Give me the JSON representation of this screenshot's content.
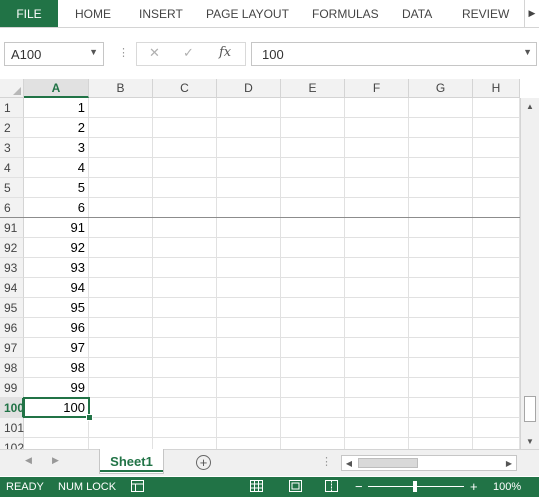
{
  "ribbon": {
    "file": "FILE",
    "tabs": [
      "HOME",
      "INSERT",
      "PAGE LAYOUT",
      "FORMULAS",
      "DATA",
      "REVIEW"
    ]
  },
  "formula_bar": {
    "name_box": "A100",
    "formula": "100"
  },
  "grid": {
    "columns": [
      "A",
      "B",
      "C",
      "D",
      "E",
      "F",
      "G",
      "H"
    ],
    "selected_column": "A",
    "rows": [
      {
        "header": "1",
        "a": "1"
      },
      {
        "header": "2",
        "a": "2"
      },
      {
        "header": "3",
        "a": "3"
      },
      {
        "header": "4",
        "a": "4"
      },
      {
        "header": "5",
        "a": "5"
      },
      {
        "header": "6",
        "a": "6"
      },
      {
        "header": "91",
        "a": "91"
      },
      {
        "header": "92",
        "a": "92"
      },
      {
        "header": "93",
        "a": "93"
      },
      {
        "header": "94",
        "a": "94"
      },
      {
        "header": "95",
        "a": "95"
      },
      {
        "header": "96",
        "a": "96"
      },
      {
        "header": "97",
        "a": "97"
      },
      {
        "header": "98",
        "a": "98"
      },
      {
        "header": "99",
        "a": "99"
      },
      {
        "header": "100",
        "a": "100"
      },
      {
        "header": "101",
        "a": ""
      },
      {
        "header": "102",
        "a": ""
      }
    ],
    "selected_row": "100"
  },
  "sheets": {
    "active": "Sheet1"
  },
  "status": {
    "ready": "READY",
    "num_lock": "NUM LOCK",
    "zoom": "100%",
    "zoom_minus": "−",
    "zoom_plus": "+"
  },
  "colors": {
    "accent": "#217346"
  }
}
